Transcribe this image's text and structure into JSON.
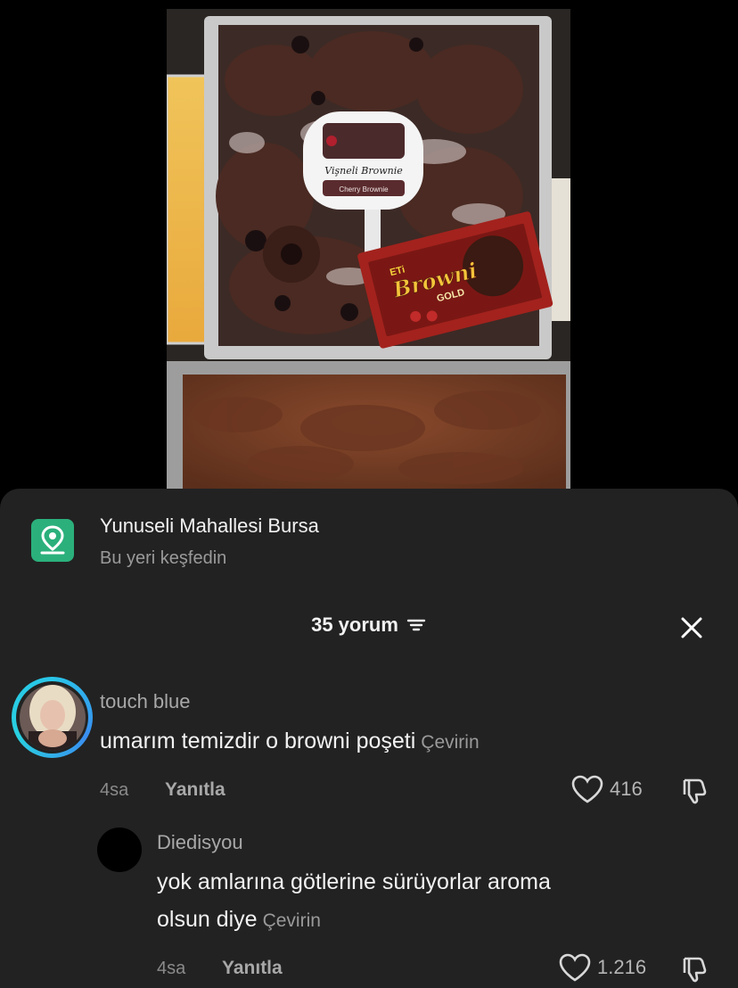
{
  "video": {
    "sign_text_1": "Vişneli Brownie",
    "sign_text_2": "Cherry Brownie",
    "package_brand": "Browni",
    "package_sub": "GOLD",
    "package_logo": "ETi"
  },
  "location": {
    "icon": "map-pin-icon",
    "title": "Yunuseli Mahallesi Bursa",
    "subtitle": "Bu yeri keşfedin"
  },
  "comments_header": {
    "count_label": "35 yorum",
    "filter_icon": "filter-icon",
    "close_icon": "close-icon"
  },
  "comments": [
    {
      "username": "touch blue",
      "text": "umarım temizdir o browni poşeti",
      "translate": "Çevirin",
      "time": "4sa",
      "reply_label": "Yanıtla",
      "likes": "416"
    },
    {
      "username": "Diedisyou",
      "text_line1": "yok amlarına götlerine sürüyorlar aroma",
      "text_line2": "olsun diye",
      "translate": "Çevirin",
      "time": "4sa",
      "reply_label": "Yanıtla",
      "likes": "1.216"
    }
  ],
  "colors": {
    "sheet_bg": "#222222",
    "location_icon_bg": "#2bb07c",
    "avatar_ring": "#29c6e8"
  }
}
